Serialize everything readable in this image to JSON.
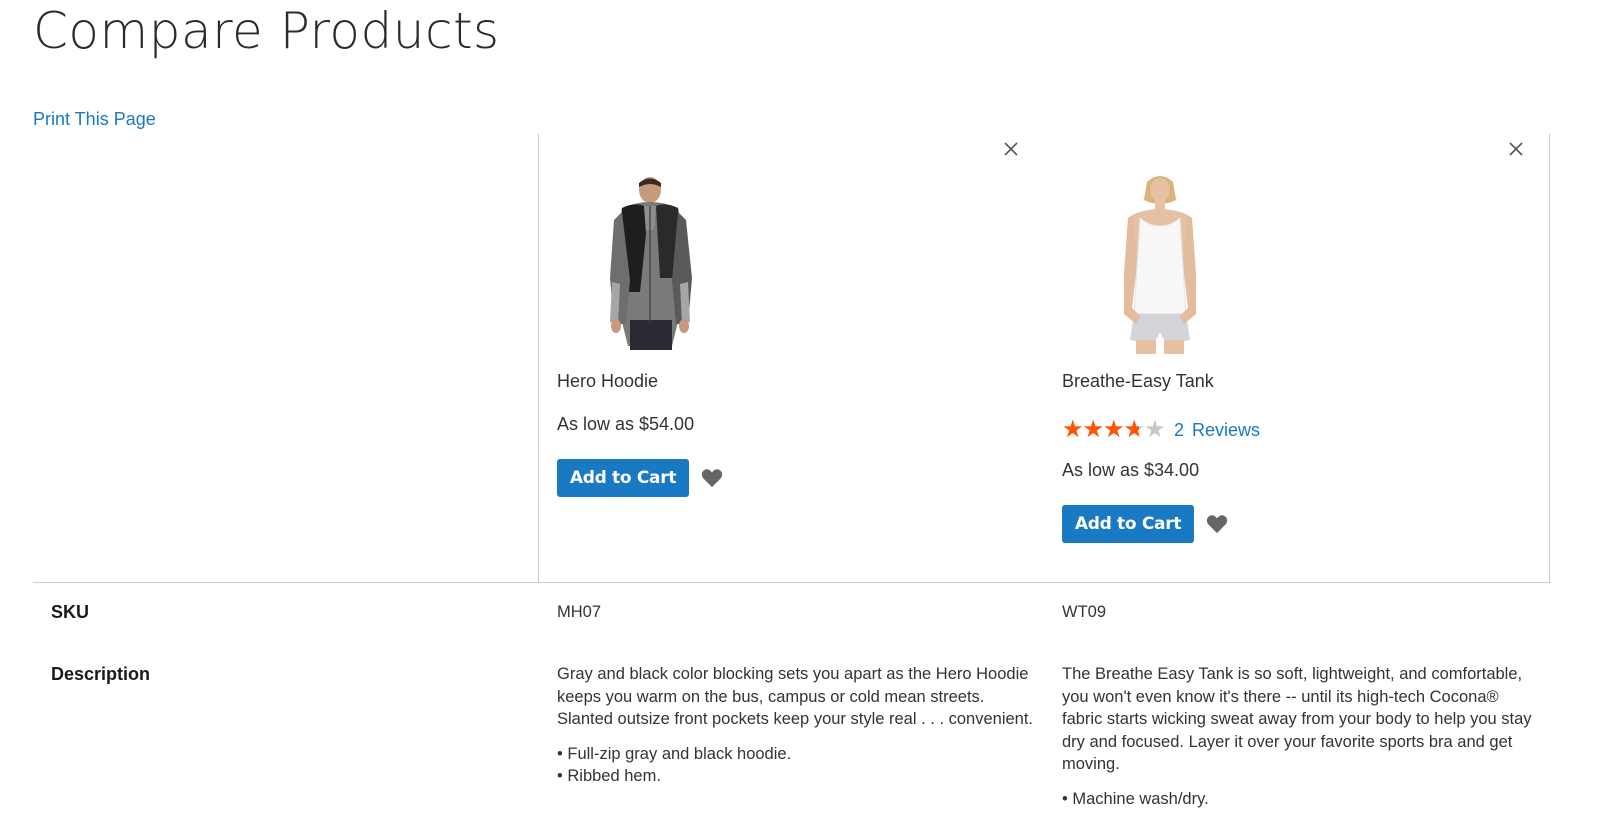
{
  "page": {
    "title": "Compare Products",
    "print_link": "Print This Page",
    "accent_color": "#1979c3",
    "star_color": "#ff5501"
  },
  "products": [
    {
      "name": "Hero Hoodie",
      "price": "As low as $54.00",
      "add_to_cart_label": "Add to Cart",
      "remove_icon": "close-icon",
      "wishlist_icon": "heart-icon",
      "sku": "MH07",
      "description": "Gray and black color blocking sets you apart as the Hero Hoodie keeps you warm on the bus, campus or cold mean streets. Slanted outsize front pockets keep your style real . . . convenient.",
      "features": [
        "Full-zip gray and black hoodie.",
        "Ribbed hem."
      ]
    },
    {
      "name": "Breathe-Easy Tank",
      "rating_percent": 70,
      "review_count": "2",
      "reviews_label": "Reviews",
      "price": "As low as $34.00",
      "add_to_cart_label": "Add to Cart",
      "remove_icon": "close-icon",
      "wishlist_icon": "heart-icon",
      "sku": "WT09",
      "description": "The Breathe Easy Tank is so soft, lightweight, and comfortable, you won't even know it's there -- until its high-tech Cocona® fabric starts wicking sweat away from your body to help you stay dry and focused. Layer it over your favorite sports bra and get moving.",
      "features": [
        "Machine wash/dry."
      ]
    }
  ],
  "attributes": {
    "sku_label": "SKU",
    "description_label": "Description"
  }
}
